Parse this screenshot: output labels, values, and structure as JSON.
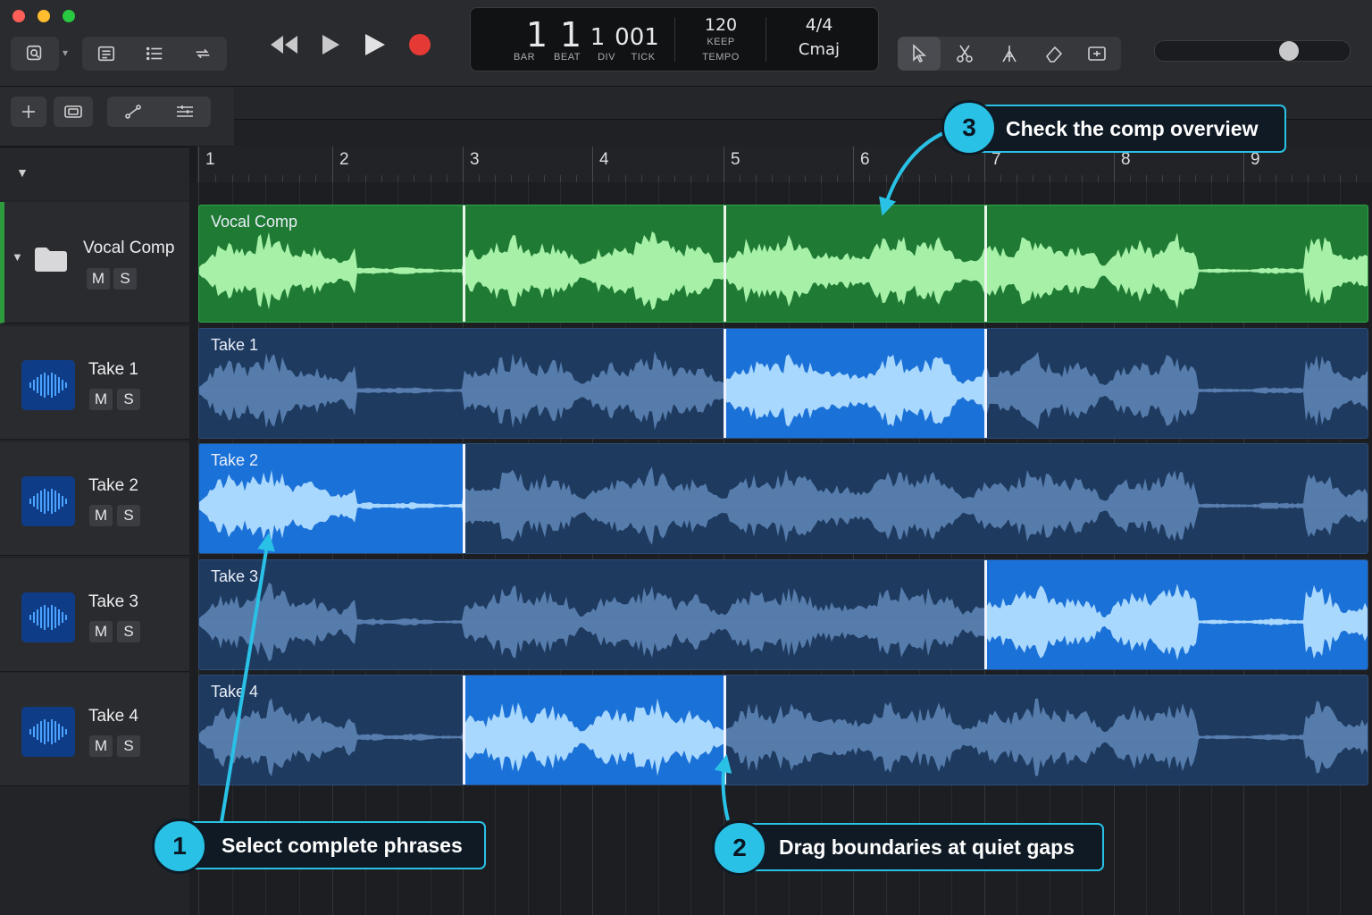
{
  "transport_display": {
    "bar": "1",
    "beat": "1",
    "div": "1",
    "tick": "001",
    "bar_label": "BAR",
    "beat_label": "BEAT",
    "div_label": "DIV",
    "tick_label": "TICK",
    "tempo": "120",
    "keep_label": "KEEP",
    "tempo_label": "TEMPO",
    "time_signature": "4/4",
    "key": "Cmaj"
  },
  "ruler": {
    "bars": [
      "1",
      "2",
      "3",
      "4",
      "5",
      "6",
      "7",
      "8",
      "9"
    ]
  },
  "tracks": [
    {
      "name": "Vocal Comp",
      "mute": "M",
      "solo": "S",
      "icon": "folder-icon"
    },
    {
      "name": "Take 1",
      "mute": "M",
      "solo": "S",
      "icon": "waveform-icon"
    },
    {
      "name": "Take 2",
      "mute": "M",
      "solo": "S",
      "icon": "waveform-icon"
    },
    {
      "name": "Take 3",
      "mute": "M",
      "solo": "S",
      "icon": "waveform-icon"
    },
    {
      "name": "Take 4",
      "mute": "M",
      "solo": "S",
      "icon": "waveform-icon"
    }
  ],
  "regions": [
    {
      "label": "Vocal Comp",
      "color": "#1f7a33",
      "wave_color": "#a6f0a8"
    },
    {
      "label": "Take 1",
      "active_bars": "5-7"
    },
    {
      "label": "Take 2",
      "active_bars": "1-3"
    },
    {
      "label": "Take 3",
      "active_bars": "7-10"
    },
    {
      "label": "Take 4",
      "active_bars": "3-5"
    }
  ],
  "callouts": [
    {
      "number": "1",
      "text": "Select complete phrases"
    },
    {
      "number": "2",
      "text": "Drag boundaries at quiet gaps"
    },
    {
      "number": "3",
      "text": "Check the comp overview"
    }
  ],
  "colors": {
    "accent": "#29c1e6",
    "active_take": "#1a72d9",
    "inactive_take": "#1e3a5f",
    "comp_green": "#1f7a33",
    "record": "#e53935"
  }
}
